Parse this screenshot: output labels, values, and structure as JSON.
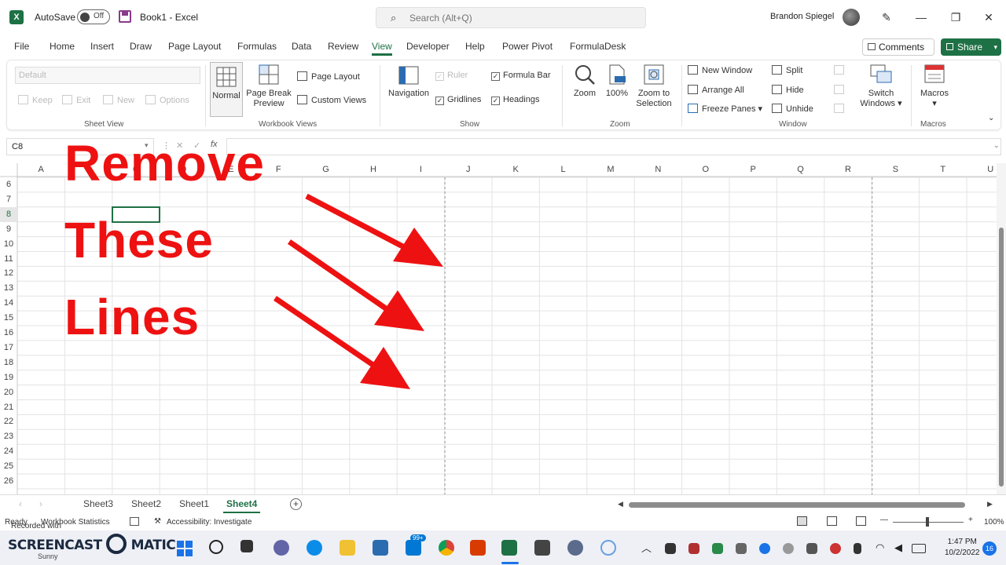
{
  "app": {
    "autosave_label": "AutoSave",
    "autosave_state": "Off",
    "doc_title": "Book1  -  Excel",
    "search_placeholder": "Search (Alt+Q)",
    "user_name": "Brandon Spiegel"
  },
  "menu": {
    "tabs": [
      "File",
      "Home",
      "Insert",
      "Draw",
      "Page Layout",
      "Formulas",
      "Data",
      "Review",
      "View",
      "Developer",
      "Help",
      "Power Pivot",
      "FormulaDesk"
    ],
    "active": "View",
    "comments_label": "Comments",
    "share_label": "Share"
  },
  "ribbon": {
    "sheet_view": {
      "dropdown_value": "Default",
      "keep": "Keep",
      "exit": "Exit",
      "new": "New",
      "options": "Options",
      "label": "Sheet View"
    },
    "workbook_views": {
      "normal": "Normal",
      "page_break_1": "Page Break",
      "page_break_2": "Preview",
      "page_layout": "Page Layout",
      "custom_views": "Custom Views",
      "label": "Workbook Views"
    },
    "show": {
      "navigation": "Navigation",
      "ruler": "Ruler",
      "gridlines": "Gridlines",
      "formula_bar": "Formula Bar",
      "headings": "Headings",
      "label": "Show"
    },
    "zoom": {
      "zoom": "Zoom",
      "hundred": "100%",
      "zoom_sel_1": "Zoom to",
      "zoom_sel_2": "Selection",
      "label": "Zoom"
    },
    "window": {
      "new_window": "New Window",
      "arrange_all": "Arrange All",
      "freeze_panes": "Freeze Panes",
      "split": "Split",
      "hide": "Hide",
      "unhide": "Unhide",
      "switch_1": "Switch",
      "switch_2": "Windows",
      "label": "Window"
    },
    "macros": {
      "macros": "Macros",
      "label": "Macros"
    }
  },
  "formula_bar": {
    "name_box": "C8",
    "fx": "fx"
  },
  "grid": {
    "columns": [
      "A",
      "B",
      "C",
      "D",
      "E",
      "F",
      "G",
      "H",
      "I",
      "J",
      "K",
      "L",
      "M",
      "N",
      "O",
      "P",
      "Q",
      "R",
      "S",
      "T",
      "U"
    ],
    "rows": [
      "6",
      "7",
      "8",
      "9",
      "10",
      "11",
      "12",
      "13",
      "14",
      "15",
      "16",
      "17",
      "18",
      "19",
      "20",
      "21",
      "22",
      "23",
      "24",
      "25",
      "26"
    ],
    "selected_cell": "C8"
  },
  "sheets": {
    "tabs": [
      "Sheet3",
      "Sheet2",
      "Sheet1",
      "Sheet4"
    ],
    "active": "Sheet4"
  },
  "status": {
    "ready_text": "Ready",
    "stats_text": "Workbook Statistics",
    "accessibility": "Accessibility: Investigate",
    "zoom_level": "100%"
  },
  "taskbar": {
    "watermark_top": "Recorded with",
    "watermark": "SCREENCAST",
    "watermark_2": "MATIC",
    "weather": "Sunny",
    "time": "1:47 PM",
    "date": "10/2/2022",
    "notification_count": "16",
    "badge": "99+"
  },
  "annotation": {
    "line1": "Remove",
    "line2": "These",
    "line3": "Lines",
    "color": "#ee1111"
  },
  "colors": {
    "excel_green": "#1e7145",
    "accent_red": "#ee1111"
  }
}
